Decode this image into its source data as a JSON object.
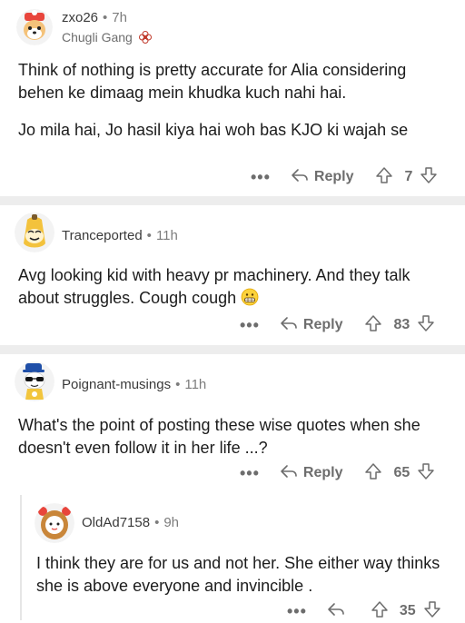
{
  "comments": [
    {
      "username": "zxo26",
      "time": "7h",
      "flair": "Chugli Gang",
      "paragraphs": [
        "Think of nothing is pretty accurate for Alia considering behen ke dimaag mein khudka kuch nahi hai.",
        "Jo mila hai, Jo hasil kiya hai woh bas KJO ki wajah se"
      ],
      "more_label": "•••",
      "reply_label": "Reply",
      "score": "7"
    },
    {
      "username": "Tranceported",
      "time": "11h",
      "paragraphs": [
        "Avg looking kid with heavy pr machinery. And they talk about struggles. Cough cough"
      ],
      "more_label": "•••",
      "reply_label": "Reply",
      "score": "83"
    },
    {
      "username": "Poignant-musings",
      "time": "11h",
      "paragraphs": [
        "What's the point of posting these wise quotes when she doesn't even follow it in her life ...?"
      ],
      "more_label": "•••",
      "reply_label": "Reply",
      "score": "65"
    },
    {
      "username": "OldAd7158",
      "time": "9h",
      "paragraphs": [
        "I think they are for us and not her. She either way thinks she is above everyone and invincible ."
      ],
      "more_label": "•••",
      "score": "35"
    }
  ],
  "icons": {
    "reply": "reply-arrow-icon",
    "upvote": "upvote-arrow-icon",
    "downvote": "downvote-arrow-icon",
    "flair": "flower-icon",
    "emoji": "grimacing-face-emoji"
  },
  "colors": {
    "text": "#1c1c1c",
    "meta": "#7c7c7c",
    "divider": "#ededed"
  }
}
